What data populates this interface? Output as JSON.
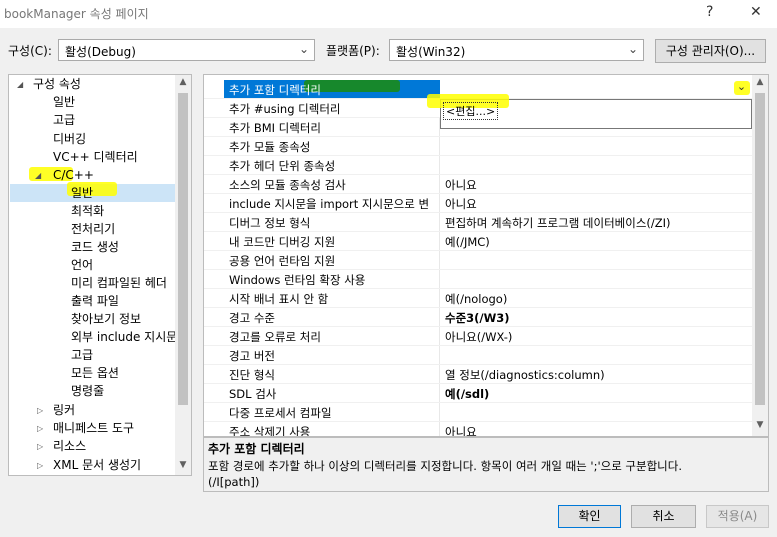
{
  "window": {
    "title": "bookManager 속성 페이지",
    "help_label": "?",
    "close_label": "✕"
  },
  "config": {
    "config_label": "구성(C):",
    "config_value": "활성(Debug)",
    "platform_label": "플랫폼(P):",
    "platform_value": "활성(Win32)",
    "manager_button": "구성 관리자(O)..."
  },
  "tree": {
    "root": "구성 속성",
    "general": "일반",
    "advanced": "고급",
    "debugging": "디버깅",
    "vc_dirs": "VC++ 디렉터리",
    "cpp": "C/C++",
    "cpp_children": [
      "일반",
      "최적화",
      "전처리기",
      "코드 생성",
      "언어",
      "미리 컴파일된 헤더",
      "출력 파일",
      "찾아보기 정보",
      "외부 include 지시문",
      "고급",
      "모든 옵션",
      "명령줄"
    ],
    "linker": "링커",
    "manifest": "매니페스트 도구",
    "resources": "리소스",
    "xml": "XML 문서 생성기"
  },
  "grid": {
    "rows": [
      {
        "name": "추가 포함 디렉터리",
        "value": ""
      },
      {
        "name": "추가 #using 디렉터리",
        "value": ""
      },
      {
        "name": "추가 BMI 디렉터리",
        "value": ""
      },
      {
        "name": "추가 모듈 종속성",
        "value": ""
      },
      {
        "name": "추가 헤더 단위 종속성",
        "value": ""
      },
      {
        "name": "소스의 모듈 종속성 검사",
        "value": "아니요"
      },
      {
        "name": "include 지시문을 import 지시문으로 변",
        "value": "아니요"
      },
      {
        "name": "디버그 정보 형식",
        "value": "편집하며 계속하기 프로그램 데이터베이스(/ZI)"
      },
      {
        "name": "내 코드만 디버깅 지원",
        "value": "예(/JMC)"
      },
      {
        "name": "공용 언어 런타임 지원",
        "value": ""
      },
      {
        "name": "Windows 런타임 확장 사용",
        "value": ""
      },
      {
        "name": "시작 배너 표시 안 함",
        "value": "예(/nologo)"
      },
      {
        "name": "경고 수준",
        "value": "수준3(/W3)"
      },
      {
        "name": "경고를 오류로 처리",
        "value": "아니요(/WX-)"
      },
      {
        "name": "경고 버전",
        "value": ""
      },
      {
        "name": "진단 형식",
        "value": "열 정보(/diagnostics:column)"
      },
      {
        "name": "SDL 검사",
        "value": "예(/sdl)"
      },
      {
        "name": "다중 프로세서 컴파일",
        "value": ""
      },
      {
        "name": "주소 삭제기 사용",
        "value": "아니요"
      }
    ],
    "dropdown_item": "<편집...>"
  },
  "description": {
    "title": "추가 포함 디렉터리",
    "text": "포함 경로에 추가할 하나 이상의 디렉터리를 지정합니다. 항목이 여러 개일 때는 ';'으로 구분합니다.",
    "switch": "(/I[path])"
  },
  "buttons": {
    "ok": "확인",
    "cancel": "취소",
    "apply": "적용(A)"
  },
  "colors": {
    "selection": "#0078d7",
    "highlight": "#ffff00",
    "highlight_green": "#1a8a1a"
  }
}
